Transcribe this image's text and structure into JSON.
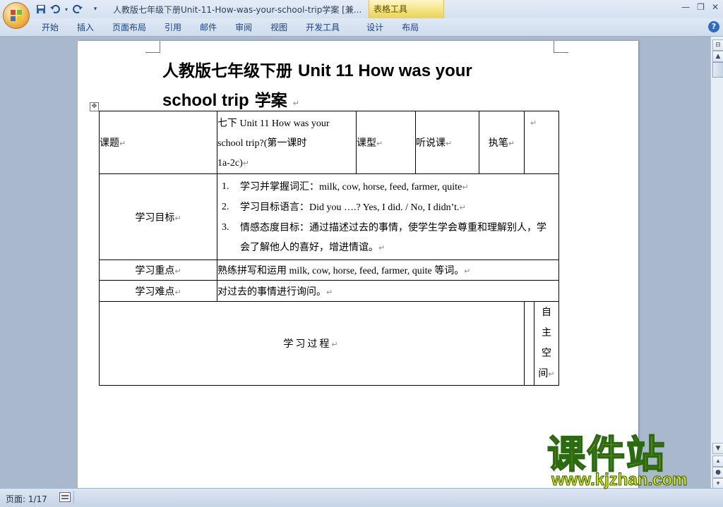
{
  "app": {
    "title": "人教版七年级下册Unit-11-How-was-your-school-trip学案 [兼...",
    "context_tab": "表格工具",
    "window_controls": [
      "minimize-icon",
      "restore-icon",
      "close-icon"
    ]
  },
  "quick_access": [
    "save-icon",
    "undo-icon",
    "redo-icon",
    "customize-icon"
  ],
  "ribbon": {
    "tabs": [
      "开始",
      "插入",
      "页面布局",
      "引用",
      "邮件",
      "审阅",
      "视图",
      "开发工具",
      "设计",
      "布局"
    ],
    "help": "?"
  },
  "document": {
    "title_cn_1": "人教版七年级下册",
    "title_en_1": "Unit 11 How was your",
    "title_en_2": "school trip",
    "title_cn_2": "学案",
    "para_mark": "↵",
    "table": {
      "r1": {
        "c1": "课题",
        "c2_l1": "七下 Unit 11 How was your",
        "c2_l2": "school trip?(第一课时",
        "c2_l3": "1a-2c)",
        "c3": "课型",
        "c4": "听说课",
        "c5": "执笔",
        "c6": ""
      },
      "r2": {
        "label": "学习目标",
        "items": [
          {
            "num": "1.",
            "text": "学习并掌握词汇：milk, cow, horse, feed, farmer, quite"
          },
          {
            "num": "2.",
            "text": "学习目标语言：Did you ….?    Yes, I did. / No, I didn’t."
          },
          {
            "num": "3.",
            "text": "情感态度目标：通过描述过去的事情，使学生学会尊重和理解别人，学会了解他人的喜好，增进情谊。"
          }
        ]
      },
      "r3": {
        "label": "学习重点",
        "text": "熟练拼写和运用 milk, cow, horse, feed, farmer, quite 等词。"
      },
      "r4": {
        "label": "学习难点",
        "text": "对过去的事情进行询问。"
      },
      "r5": {
        "label": "学习过程",
        "side": [
          "自",
          "主",
          "空",
          "间"
        ]
      }
    }
  },
  "status": {
    "page": "页面: 1/17"
  },
  "watermark": {
    "cn": "课件站",
    "url": "www.kjzhan.com"
  }
}
